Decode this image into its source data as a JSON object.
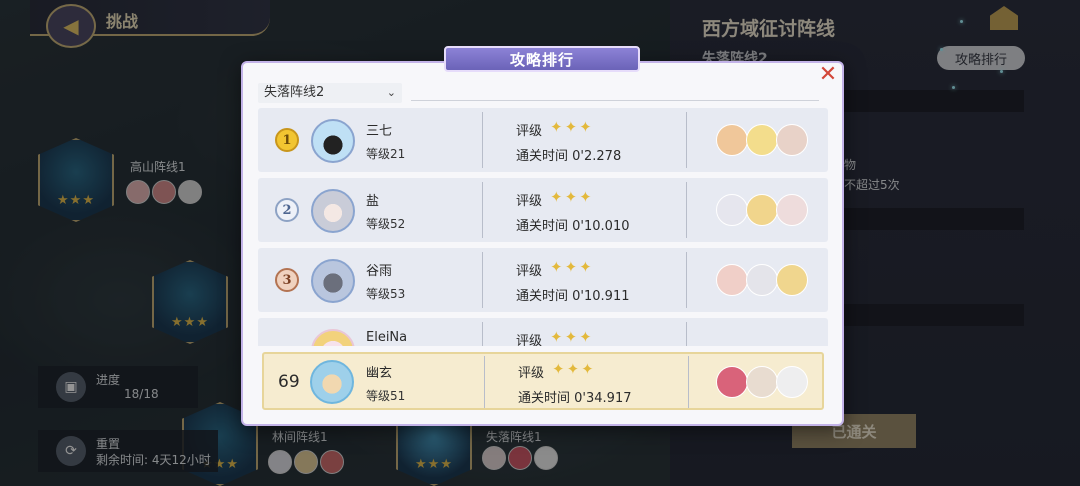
{
  "header": {
    "title": "挑战"
  },
  "map": {
    "nodes": [
      {
        "label": "高山阵线1",
        "stars": "★★★"
      },
      {
        "label": "",
        "stars": "★★★"
      },
      {
        "label": "林间阵线1",
        "stars": "★★★"
      },
      {
        "label": "失落阵线1",
        "stars": "★★★"
      }
    ],
    "progress": {
      "label": "进度",
      "value": "18/18"
    },
    "reset": {
      "label": "重置",
      "remaining": "剩余时间: 4天12小时"
    }
  },
  "right_panel": {
    "title": "西方域征讨阵线",
    "subtitle": "失落阵线2",
    "ranking_button": "攻略排行",
    "text_1": "物",
    "text_2": "不超过5次",
    "cleared_button": "已通关"
  },
  "dialog": {
    "title": "攻略排行",
    "close": "✕",
    "dropdown": {
      "selected": "失落阵线2",
      "chevron": "⌄"
    },
    "grade_label": "评级",
    "stars": "✦✦✦",
    "time_prefix": "通关时间",
    "entries": [
      {
        "rank": "1",
        "name": "三七",
        "level": "等级21",
        "time": "0'2.278",
        "avatar_color": "#bfe0f5"
      },
      {
        "rank": "2",
        "name": "盐",
        "level": "等级52",
        "time": "0'10.010",
        "avatar_color": "#e4e6ee"
      },
      {
        "rank": "3",
        "name": "谷雨",
        "level": "等级53",
        "time": "0'10.911",
        "avatar_color": "#b9c6de"
      },
      {
        "rank": "",
        "name": "EleiNa",
        "level": "",
        "time": "",
        "avatar_color": "#f6e2ec"
      }
    ],
    "mine": {
      "rank": "69",
      "name": "幽玄",
      "level": "等级51",
      "time": "0'34.917",
      "avatar_color": "#9ed0ea"
    }
  },
  "colors": {
    "dialog_accent": "#7a70c8",
    "star_gold": "#e3b93c",
    "close_red": "#d24638"
  }
}
